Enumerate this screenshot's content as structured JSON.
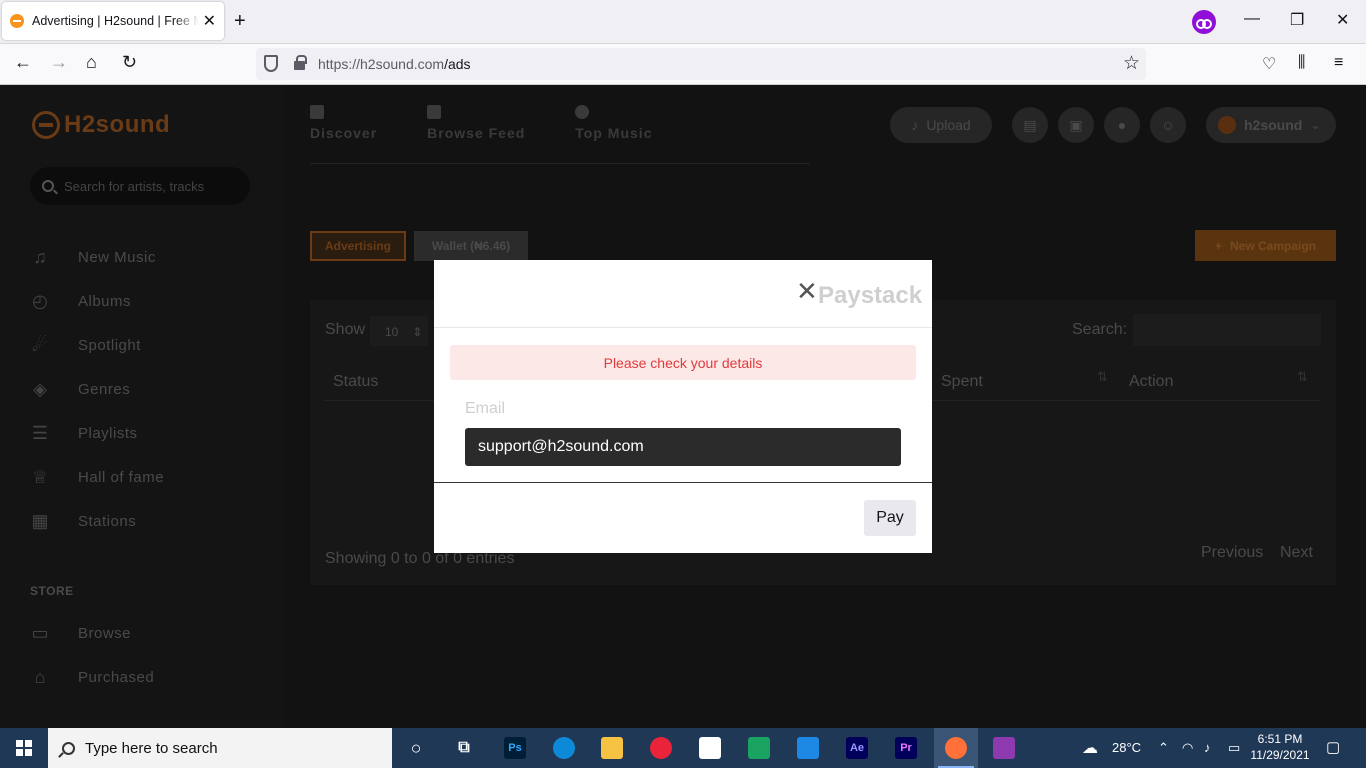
{
  "browser": {
    "tab_title": "Advertising | H2sound | Free Music",
    "url_host": "https://h2sound.com",
    "url_path": "/ads"
  },
  "site": {
    "logo": "H2sound",
    "search_placeholder": "Search for artists, tracks",
    "menu": [
      {
        "label": "New Music",
        "icon": "music-note-icon"
      },
      {
        "label": "Albums",
        "icon": "disc-icon"
      },
      {
        "label": "Spotlight",
        "icon": "spotlight-icon"
      },
      {
        "label": "Genres",
        "icon": "layers-icon"
      },
      {
        "label": "Playlists",
        "icon": "playlist-icon"
      },
      {
        "label": "Hall of fame",
        "icon": "trophy-icon"
      },
      {
        "label": "Stations",
        "icon": "calendar-icon"
      }
    ],
    "store_heading": "STORE",
    "store_menu": [
      {
        "label": "Browse",
        "icon": "browse-icon"
      },
      {
        "label": "Purchased",
        "icon": "basket-icon"
      }
    ],
    "top_nav": [
      "Discover",
      "Browse Feed",
      "Top Music"
    ],
    "upload_label": "Upload",
    "username": "h2sound",
    "tabs": {
      "advertising": "Advertising",
      "wallet": "Wallet (₦6.46)"
    },
    "new_campaign": "New Campaign",
    "table": {
      "show_label": "Show",
      "show_value": "10",
      "search_label": "Search:",
      "columns": [
        "Status",
        "Spent",
        "Action"
      ],
      "info": "Showing 0 to 0 of 0 entries",
      "prev": "Previous",
      "next": "Next"
    }
  },
  "modal": {
    "title": "Paystack",
    "alert": "Please check your details",
    "email_label": "Email",
    "email_value": "support@h2sound.com",
    "pay_label": "Pay"
  },
  "taskbar": {
    "search_placeholder": "Type here to search",
    "weather": "28°C",
    "time": "6:51 PM",
    "date": "11/29/2021"
  }
}
